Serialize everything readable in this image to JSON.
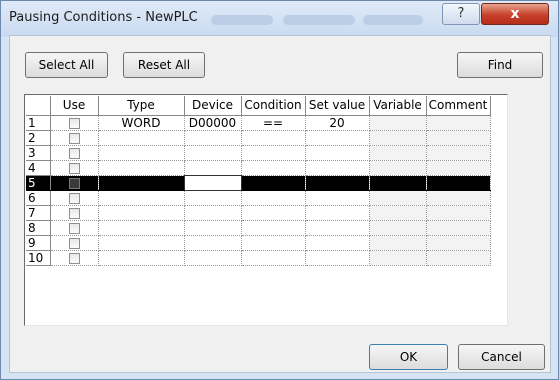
{
  "window": {
    "title": "Pausing Conditions - NewPLC",
    "help_label": "?",
    "close_label": "x"
  },
  "toolbar": {
    "select_all_label": "Select All",
    "reset_all_label": "Reset All",
    "find_label": "Find"
  },
  "grid": {
    "columns": [
      "",
      "Use",
      "Type",
      "Device",
      "Condition",
      "Set value",
      "Variable",
      "Comment"
    ],
    "rows": [
      {
        "num": "1",
        "use": false,
        "type": "WORD",
        "device": "D00000",
        "condition": "==",
        "set_value": "20",
        "variable": "",
        "comment": ""
      },
      {
        "num": "2",
        "use": false,
        "type": "",
        "device": "",
        "condition": "",
        "set_value": "",
        "variable": "",
        "comment": ""
      },
      {
        "num": "3",
        "use": false,
        "type": "",
        "device": "",
        "condition": "",
        "set_value": "",
        "variable": "",
        "comment": ""
      },
      {
        "num": "4",
        "use": false,
        "type": "",
        "device": "",
        "condition": "",
        "set_value": "",
        "variable": "",
        "comment": ""
      },
      {
        "num": "5",
        "use": false,
        "type": "",
        "device": "",
        "condition": "",
        "set_value": "",
        "variable": "",
        "comment": ""
      },
      {
        "num": "6",
        "use": false,
        "type": "",
        "device": "",
        "condition": "",
        "set_value": "",
        "variable": "",
        "comment": ""
      },
      {
        "num": "7",
        "use": false,
        "type": "",
        "device": "",
        "condition": "",
        "set_value": "",
        "variable": "",
        "comment": ""
      },
      {
        "num": "8",
        "use": false,
        "type": "",
        "device": "",
        "condition": "",
        "set_value": "",
        "variable": "",
        "comment": ""
      },
      {
        "num": "9",
        "use": false,
        "type": "",
        "device": "",
        "condition": "",
        "set_value": "",
        "variable": "",
        "comment": ""
      },
      {
        "num": "10",
        "use": false,
        "type": "",
        "device": "",
        "condition": "",
        "set_value": "",
        "variable": "",
        "comment": ""
      }
    ],
    "selected_row": "5"
  },
  "footer": {
    "ok_label": "OK",
    "cancel_label": "Cancel"
  }
}
